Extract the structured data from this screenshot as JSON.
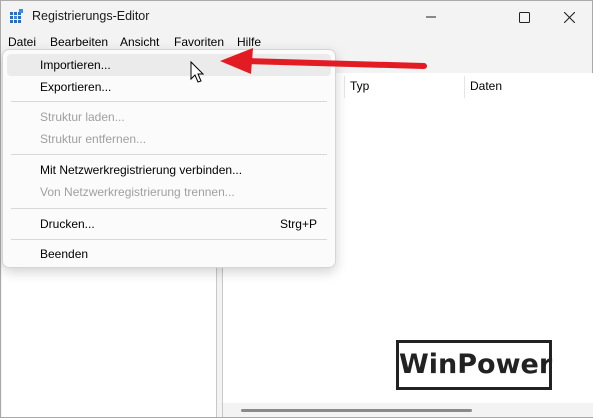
{
  "window": {
    "title": "Registrierungs-Editor"
  },
  "menubar": {
    "items": [
      "Datei",
      "Bearbeiten",
      "Ansicht",
      "Favoriten",
      "Hilfe"
    ]
  },
  "columns": [
    "Typ",
    "Daten"
  ],
  "file_menu": {
    "items": [
      {
        "label": "Importieren...",
        "enabled": true,
        "hovered": true
      },
      {
        "label": "Exportieren...",
        "enabled": true
      },
      {
        "label": "Struktur laden...",
        "enabled": false
      },
      {
        "label": "Struktur entfernen...",
        "enabled": false
      },
      {
        "label": "Mit Netzwerkregistrierung verbinden...",
        "enabled": true
      },
      {
        "label": "Von Netzwerkregistrierung trennen...",
        "enabled": false
      },
      {
        "label": "Drucken...",
        "shortcut": "Strg+P",
        "enabled": true
      },
      {
        "label": "Beenden",
        "enabled": true
      }
    ]
  },
  "watermark": {
    "text": "WinPower"
  },
  "colors": {
    "arrow": "#e31b23",
    "icon_blue": "#1e6fd0"
  }
}
